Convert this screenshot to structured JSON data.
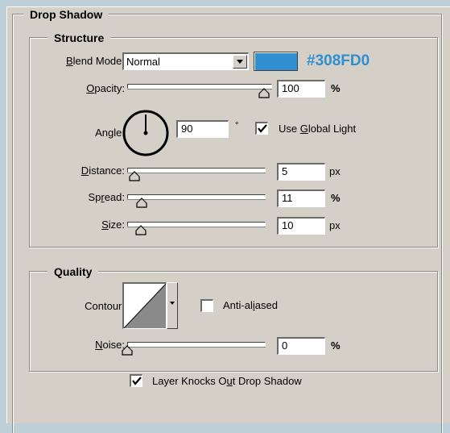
{
  "drop_shadow": {
    "title": "Drop Shadow",
    "structure": {
      "title": "Structure",
      "blend_mode": {
        "label_prefix": "",
        "label_underline": "B",
        "label_suffix": "lend Mode:",
        "value": "Normal",
        "color_hex": "#308FD0",
        "color_label": "#308FD0"
      },
      "opacity": {
        "label_underline": "O",
        "label_suffix": "pacity:",
        "value": "100",
        "unit": "%",
        "level": 1.0
      },
      "angle": {
        "label": "Angle:",
        "value": "90",
        "unit": "°",
        "degrees": 90
      },
      "use_global_light": {
        "checked": true,
        "label_prefix": "Use ",
        "label_underline": "G",
        "label_suffix": "lobal Light"
      },
      "distance": {
        "label_underline": "D",
        "label_suffix": "istance:",
        "value": "5",
        "unit": "px"
      },
      "spread": {
        "label_prefix": "Sp",
        "label_underline": "r",
        "label_suffix": "ead:",
        "value": "11",
        "unit": "%",
        "level": 0.11
      },
      "size": {
        "label_prefix": "",
        "label_underline": "S",
        "label_suffix": "ize:",
        "value": "10",
        "unit": "px"
      }
    },
    "quality": {
      "title": "Quality",
      "contour": {
        "label": "Contour:"
      },
      "anti_aliased": {
        "checked": false,
        "label_prefix": "Anti-al",
        "label_underline": "i",
        "label_suffix": "ased"
      },
      "noise": {
        "label_underline": "N",
        "label_suffix": "oise:",
        "value": "0",
        "unit": "%",
        "level": 0.0
      }
    },
    "layer_knocks_out": {
      "checked": true,
      "label_prefix": "Layer Knocks O",
      "label_underline": "u",
      "label_suffix": "t Drop Shadow"
    }
  }
}
